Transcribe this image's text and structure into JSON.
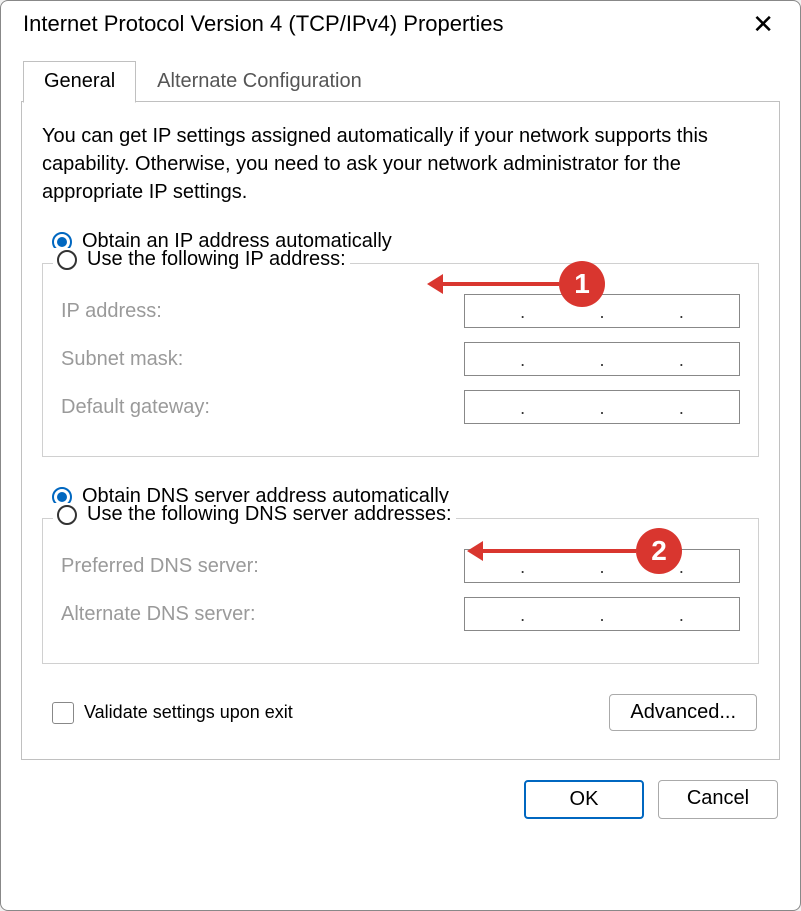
{
  "window": {
    "title": "Internet Protocol Version 4 (TCP/IPv4) Properties"
  },
  "tabs": {
    "general": "General",
    "alternate": "Alternate Configuration"
  },
  "description": "You can get IP settings assigned automatically if your network supports this capability. Otherwise, you need to ask your network administrator for the appropriate IP settings.",
  "ip_section": {
    "auto_label": "Obtain an IP address automatically",
    "manual_label": "Use the following IP address:",
    "ip_address_label": "IP address:",
    "subnet_label": "Subnet mask:",
    "gateway_label": "Default gateway:",
    "selected": "auto"
  },
  "dns_section": {
    "auto_label": "Obtain DNS server address automatically",
    "manual_label": "Use the following DNS server addresses:",
    "preferred_label": "Preferred DNS server:",
    "alternate_label": "Alternate DNS server:",
    "selected": "auto"
  },
  "validate_label": "Validate settings upon exit",
  "validate_checked": false,
  "buttons": {
    "advanced": "Advanced...",
    "ok": "OK",
    "cancel": "Cancel"
  },
  "annotations": {
    "one": "1",
    "two": "2"
  }
}
